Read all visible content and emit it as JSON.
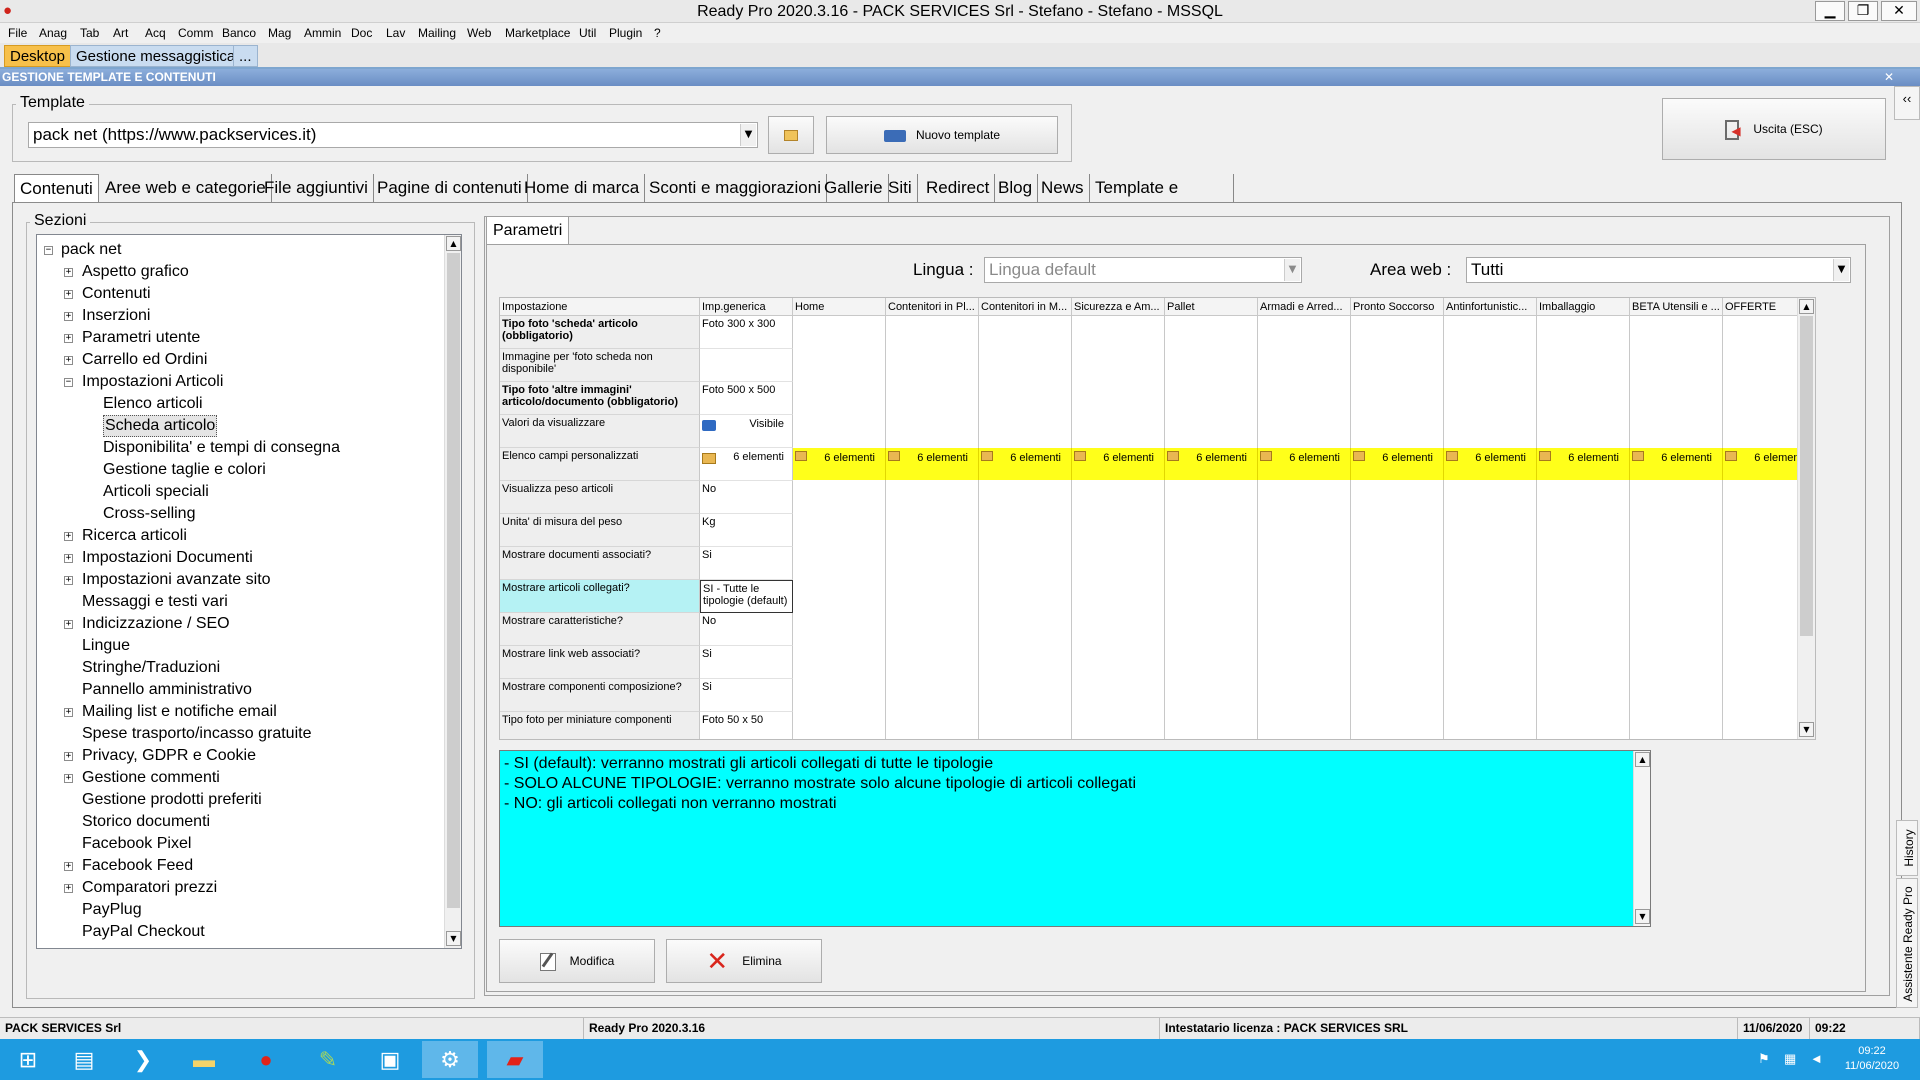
{
  "window": {
    "title": "Ready Pro 2020.3.16 - PACK SERVICES Srl - Stefano - Stefano - MSSQL",
    "min_label": "▁",
    "restore_label": "❐",
    "close_label": "✕"
  },
  "menu": [
    "File",
    "Anag",
    "Tab",
    "Art",
    "Acq",
    "Comm",
    "Banco",
    "Mag",
    "Ammin",
    "Doc",
    "Lav",
    "Mailing",
    "Web",
    "Marketplace",
    "Util",
    "Plugin",
    "?"
  ],
  "doc_tabs": [
    "Desktop",
    "Gestione messaggistica",
    "..."
  ],
  "section_header": "GESTIONE TEMPLATE E CONTENUTI",
  "template": {
    "group_label": "Template",
    "selected": "pack net (https://www.packservices.it)",
    "new_button": "Nuovo template",
    "exit_button": "Uscita (ESC)"
  },
  "top_tabs": [
    "Contenuti",
    "Aree web e categorie",
    "File aggiuntivi",
    "Pagine di contenuti",
    "Home di marca",
    "Sconti e maggiorazioni",
    "Gallerie",
    "Siti",
    "Redirect",
    "Blog",
    "News",
    "Template e plugins"
  ],
  "sections": {
    "label": "Sezioni",
    "root": "pack net",
    "items": [
      {
        "label": "Aspetto grafico",
        "level": 1,
        "expander": "+"
      },
      {
        "label": "Contenuti",
        "level": 1,
        "expander": "+"
      },
      {
        "label": "Inserzioni",
        "level": 1,
        "expander": "+"
      },
      {
        "label": "Parametri utente",
        "level": 1,
        "expander": "+"
      },
      {
        "label": "Carrello ed Ordini",
        "level": 1,
        "expander": "+"
      },
      {
        "label": "Impostazioni Articoli",
        "level": 1,
        "expander": "−"
      },
      {
        "label": "Elenco articoli",
        "level": 2,
        "expander": ""
      },
      {
        "label": "Scheda articolo",
        "level": 2,
        "expander": "",
        "selected": true
      },
      {
        "label": "Disponibilita' e tempi di consegna",
        "level": 2,
        "expander": ""
      },
      {
        "label": "Gestione taglie e colori",
        "level": 2,
        "expander": ""
      },
      {
        "label": "Articoli speciali",
        "level": 2,
        "expander": ""
      },
      {
        "label": "Cross-selling",
        "level": 2,
        "expander": ""
      },
      {
        "label": "Ricerca articoli",
        "level": 1,
        "expander": "+"
      },
      {
        "label": "Impostazioni Documenti",
        "level": 1,
        "expander": "+"
      },
      {
        "label": "Impostazioni avanzate sito",
        "level": 1,
        "expander": "+"
      },
      {
        "label": "Messaggi e testi vari",
        "level": 1,
        "expander": ""
      },
      {
        "label": "Indicizzazione / SEO",
        "level": 1,
        "expander": "+"
      },
      {
        "label": "Lingue",
        "level": 1,
        "expander": ""
      },
      {
        "label": "Stringhe/Traduzioni",
        "level": 1,
        "expander": ""
      },
      {
        "label": "Pannello amministrativo",
        "level": 1,
        "expander": ""
      },
      {
        "label": "Mailing list e notifiche email",
        "level": 1,
        "expander": "+"
      },
      {
        "label": "Spese trasporto/incasso gratuite",
        "level": 1,
        "expander": ""
      },
      {
        "label": "Privacy, GDPR e Cookie",
        "level": 1,
        "expander": "+"
      },
      {
        "label": "Gestione commenti",
        "level": 1,
        "expander": "+"
      },
      {
        "label": "Gestione prodotti preferiti",
        "level": 1,
        "expander": ""
      },
      {
        "label": "Storico documenti",
        "level": 1,
        "expander": ""
      },
      {
        "label": "Facebook Pixel",
        "level": 1,
        "expander": ""
      },
      {
        "label": "Facebook Feed",
        "level": 1,
        "expander": "+"
      },
      {
        "label": "Comparatori prezzi",
        "level": 1,
        "expander": "+"
      },
      {
        "label": "PayPlug",
        "level": 1,
        "expander": ""
      },
      {
        "label": "PayPal Checkout",
        "level": 1,
        "expander": ""
      }
    ]
  },
  "params": {
    "tab": "Parametri",
    "lingua_label": "Lingua :",
    "lingua_value": "Lingua default",
    "area_label": "Area web :",
    "area_value": "Tutti"
  },
  "grid": {
    "headers": [
      "Impostazione",
      "Imp.generica",
      "Home",
      "Contenitori in Pl...",
      "Contenitori in M...",
      "Sicurezza e Am...",
      "Pallet",
      "Armadi e Arred...",
      "Pronto Soccorso",
      "Antinfortunistic...",
      "Imballaggio",
      "BETA Utensili e ...",
      "OFFERTE"
    ],
    "rows": [
      {
        "label": "Tipo foto 'scheda' articolo (obbligatorio)",
        "bold": true,
        "value": "Foto 300 x 300"
      },
      {
        "label": "Immagine per 'foto scheda non disponibile'",
        "bold": false,
        "value": ""
      },
      {
        "label": "Tipo foto 'altre immagini' articolo/documento (obbligatorio)",
        "bold": true,
        "value": "Foto 500 x 500"
      },
      {
        "label": "Valori da visualizzare",
        "bold": false,
        "value": "Visibile"
      },
      {
        "label": "Elenco campi personalizzati",
        "bold": false,
        "value": "6 elementi"
      },
      {
        "label": "Visualizza peso articoli",
        "bold": false,
        "value": "No"
      },
      {
        "label": "Unita' di misura del peso",
        "bold": false,
        "value": "Kg"
      },
      {
        "label": "Mostrare documenti associati?",
        "bold": false,
        "value": "Si"
      },
      {
        "label": "Mostrare articoli collegati?",
        "bold": false,
        "value": "SI - Tutte le tipologie (default)",
        "selected": true
      },
      {
        "label": "Mostrare caratteristiche?",
        "bold": false,
        "value": "No"
      },
      {
        "label": "Mostrare link web associati?",
        "bold": false,
        "value": "Si"
      },
      {
        "label": "Mostrare componenti composizione?",
        "bold": false,
        "value": "Si"
      },
      {
        "label": "Tipo foto per miniature componenti",
        "bold": false,
        "value": "Foto 50 x 50"
      }
    ],
    "yellow_value": "6 elementi"
  },
  "help_lines": [
    "- SI (default): verranno mostrati gli articoli collegati di tutte le tipologie",
    "- SOLO ALCUNE TIPOLOGIE: verranno mostrate solo alcune tipologie di articoli collegati",
    "- NO: gli articoli collegati non verranno mostrati"
  ],
  "actions": {
    "edit": "Modifica",
    "delete": "Elimina"
  },
  "side": {
    "history": "History",
    "assistant": "Assistente Ready Pro"
  },
  "status": {
    "company": "PACK SERVICES Srl",
    "version": "Ready Pro 2020.3.16",
    "license": "Intestatario licenza : PACK SERVICES SRL",
    "date": "11/06/2020",
    "time": "09:22"
  },
  "taskbar": {
    "clock_time": "09:22",
    "clock_date": "11/06/2020"
  },
  "colors": {
    "help_bg": "#00ffff",
    "selected_row": "#b5f2f4",
    "yellow": "#ffff1a",
    "taskbar": "#1e9be0"
  }
}
